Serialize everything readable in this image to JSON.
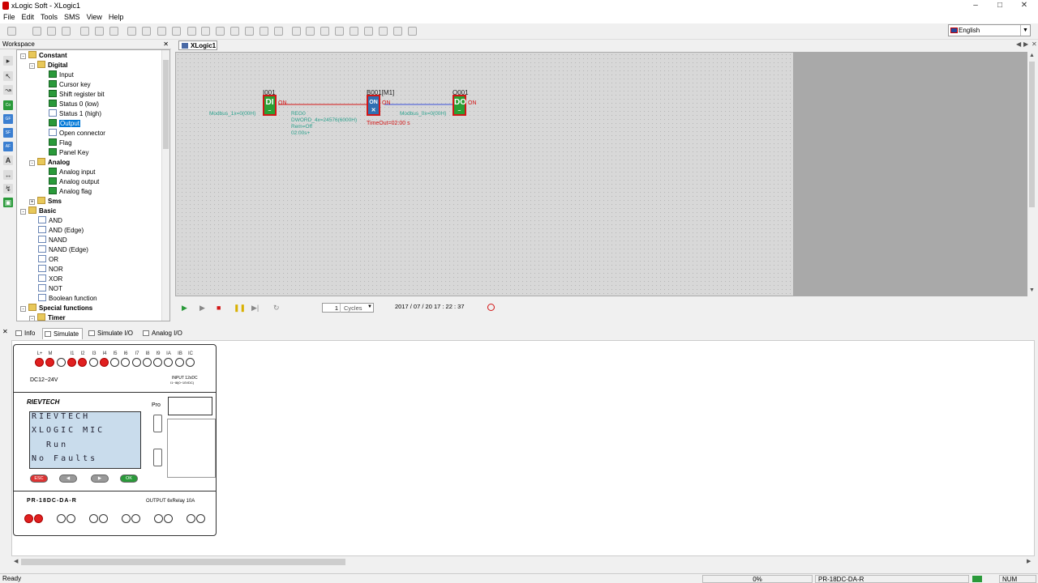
{
  "window": {
    "title": "xLogic Soft - XLogic1"
  },
  "menu": [
    "File",
    "Edit",
    "Tools",
    "SMS",
    "View",
    "Help"
  ],
  "language": {
    "selected": "English"
  },
  "workspace": {
    "title": "Workspace"
  },
  "tree": {
    "constant": "Constant",
    "digital": "Digital",
    "digital_items": [
      "Input",
      "Cursor key",
      "Shift register bit",
      "Status 0 (low)",
      "Status 1 (high)",
      "Output",
      "Open connector",
      "Flag",
      "Panel Key"
    ],
    "analog": "Analog",
    "analog_items": [
      "Analog input",
      "Analog output",
      "Analog flag"
    ],
    "sms": "Sms",
    "basic": "Basic",
    "basic_items": [
      "AND",
      "AND (Edge)",
      "NAND",
      "NAND (Edge)",
      "OR",
      "NOR",
      "XOR",
      "NOT",
      "Boolean function"
    ],
    "special": "Special functions",
    "timer": "Timer",
    "icon_glyphs": {
      "input": "DI",
      "status0": "0",
      "status1": "1",
      "output": "DO",
      "connector": "X"
    }
  },
  "doc_tab": {
    "label": "XLogic1"
  },
  "canvas": {
    "block_i001": {
      "name": "I001",
      "glyph": "DI",
      "state": "ON",
      "note": "Modbus_1x=0(00H)"
    },
    "block_b001": {
      "name": "B001[M1]",
      "glyph": "ON",
      "state": "ON",
      "timeout": "TimeOut=02:00 s",
      "note1": "REG0",
      "note2": "DWORD_4x=24576(6000H)",
      "note3": "Rem=Off",
      "note4": "02:00s+"
    },
    "block_q001": {
      "name": "Q001",
      "glyph": "DO",
      "state": "ON",
      "note": "Modbus_0x=0(00H)"
    }
  },
  "sim": {
    "cycles_value": "1",
    "cycles_label": "Cycles",
    "datetime": "2017 / 07 / 20 17 : 22 : 37"
  },
  "bottom_tabs": [
    "Info",
    "Simulate",
    "Simulate I/O",
    "Analog I/O"
  ],
  "plc": {
    "terminals": [
      "L+",
      "M",
      "I1",
      "I2",
      "I3",
      "I4",
      "I5",
      "I6",
      "I7",
      "I8",
      "I9",
      "IA",
      "IB",
      "IC"
    ],
    "inputs_on": [
      true,
      true,
      false,
      true,
      false,
      false,
      false,
      false,
      false,
      false,
      false,
      false
    ],
    "power_label": "DC12~24V",
    "input_spec": "INPUT 12xDC",
    "input_sub": "I1~I8(0~10VDC)",
    "brand": "RIEVTECH",
    "lcd": [
      "RIEVTECH",
      "XLOGIC MIC",
      "  Run",
      "No Faults"
    ],
    "buttons": [
      "ESC",
      "◀",
      "▶",
      "OK"
    ],
    "pro_label": "Pro",
    "model": "PR-18DC-DA-R",
    "output_spec": "OUTPUT 6xRelay 10A",
    "outputs_on": [
      true,
      false,
      false,
      false,
      false,
      false
    ]
  },
  "status": {
    "ready": "Ready",
    "progress": "0%",
    "model": "PR-18DC-DA-R",
    "num": "NUM"
  },
  "colors": {
    "block_green": "#2aa034",
    "wire_red": "#d31616",
    "wire_blue": "#3a4fd8",
    "led_on": "#e02020",
    "selection": "#0078d7"
  }
}
